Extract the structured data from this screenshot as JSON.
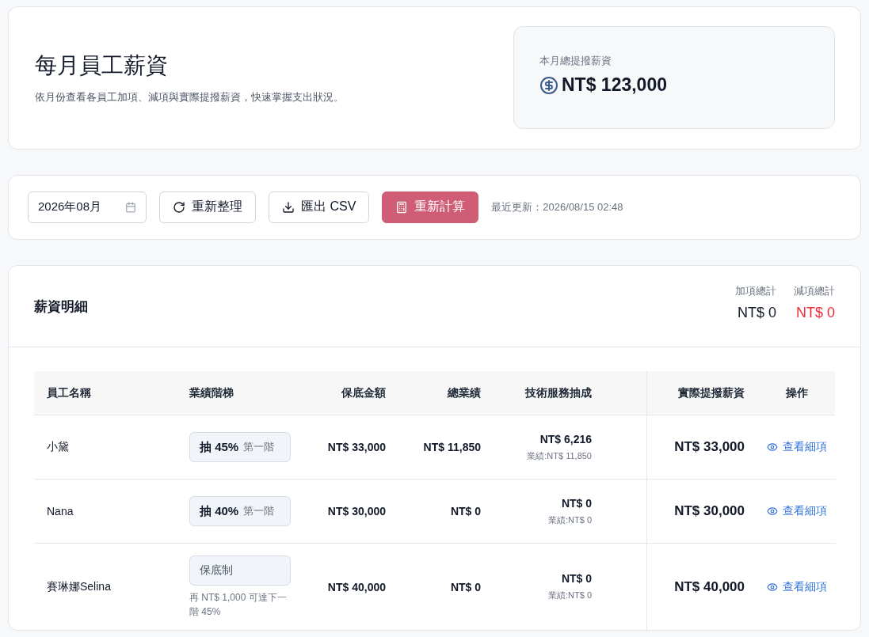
{
  "header": {
    "title": "每月員工薪資",
    "subtitle": "依月份查看各員工加項、減項與實際提撥薪資，快速掌握支出狀況。",
    "total": {
      "label": "本月總提撥薪資",
      "value": "NT$ 123,000"
    }
  },
  "toolbar": {
    "month": "2026年08月",
    "buttons": [
      {
        "kind": "refresh",
        "label": "重新整理"
      },
      {
        "kind": "export",
        "label": "匯出 CSV"
      },
      {
        "kind": "recalc",
        "label": "重新計算"
      }
    ],
    "updated": "最近更新：2026/08/15 02:48"
  },
  "details": {
    "title": "薪資明細",
    "summary": [
      {
        "label": "加項總計",
        "value": "NT$ 0",
        "kind": "plus"
      },
      {
        "label": "減項總計",
        "value": "NT$ 0",
        "kind": "minus"
      }
    ],
    "columns": [
      "員工名稱",
      "業績階梯",
      "保底金額",
      "總業績",
      "技術服務抽成",
      "實際提撥薪資",
      "操作"
    ],
    "rows": [
      {
        "name": "小黛",
        "tier": {
          "kind": "rate",
          "rate": "抽 45%",
          "step": "第一階"
        },
        "base": "NT$ 33,000",
        "sales": "NT$ 11,850",
        "commission": "NT$ 6,216",
        "commission_note": "業績:NT$ 11,850",
        "actual": "NT$ 33,000",
        "action": "查看細項"
      },
      {
        "name": "Nana",
        "tier": {
          "kind": "rate",
          "rate": "抽 40%",
          "step": "第一階"
        },
        "base": "NT$ 30,000",
        "sales": "NT$ 0",
        "commission": "NT$ 0",
        "commission_note": "業績:NT$ 0",
        "actual": "NT$ 30,000",
        "action": "查看細項"
      },
      {
        "name": "賽琳娜Selina",
        "tier": {
          "kind": "base",
          "label": "保底制",
          "note": "再 NT$ 1,000 可達下一階 45%"
        },
        "base": "NT$ 40,000",
        "sales": "NT$ 0",
        "commission": "NT$ 0",
        "commission_note": "業績:NT$ 0",
        "actual": "NT$ 40,000",
        "action": "查看細項"
      }
    ]
  }
}
